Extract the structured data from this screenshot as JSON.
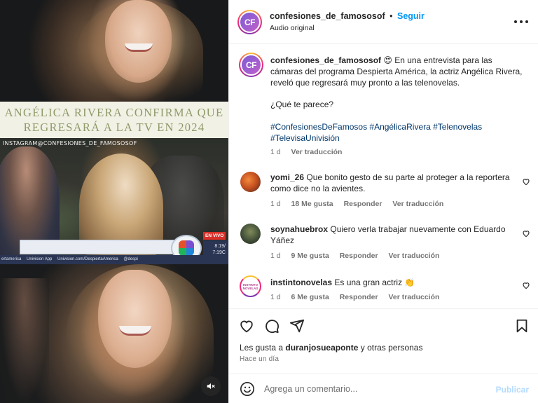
{
  "media": {
    "headline_line1": "ANGÉLICA RIVERA CONFIRMA QUE",
    "headline_line2": "REGRESARÁ A LA TV EN 2024",
    "watermark": "INSTAGRAM@CONFESIONES_DE_FAMOSOSOF",
    "live_badge": "EN VIVO",
    "time_line1": "8:19/",
    "time_line2": "7:19C",
    "ticker": [
      "ertamerica",
      "Univision App",
      "Univision.com/DespiertaAmerica",
      "@despi"
    ],
    "mute_icon": "muted-speaker-icon"
  },
  "header": {
    "avatar_text": "CF",
    "username": "confesiones_de_famososof",
    "separator": "•",
    "follow": "Seguir",
    "subtitle": "Audio original",
    "more_icon": "more-options-icon"
  },
  "caption": {
    "username": "confesiones_de_famososof",
    "emoji": "😍",
    "body": "En una entrevista para las cámaras del programa Despierta América, la actriz Angélica Rivera, reveló que regresará muy pronto a las telenovelas.",
    "question": "¿Qué te parece?",
    "hashtags_line1": "#ConfesionesDeFamosos #AngélicaRivera #Telenovelas",
    "hashtags_line2": "#TelevisaUnivisión",
    "time": "1 d",
    "translate": "Ver traducción"
  },
  "comments": [
    {
      "username": "yomi_26",
      "text": "Que bonito gesto de su parte al proteger a la reportera como dice no la avientes.",
      "time": "1 d",
      "likes": "18 Me gusta",
      "reply": "Responder",
      "translate": "Ver traducción"
    },
    {
      "username": "soynahuebrox",
      "text": "Quiero verla trabajar nuevamente con Eduardo Yáñez",
      "time": "1 d",
      "likes": "9 Me gusta",
      "reply": "Responder",
      "translate": "Ver traducción"
    },
    {
      "username": "instintonovelas",
      "avatar_text": "INSTINTO NOVELAS",
      "text": "Es una gran actriz",
      "emoji": "👏",
      "time": "1 d",
      "likes": "6 Me gusta",
      "reply": "Responder",
      "translate": "Ver traducción"
    }
  ],
  "likes": {
    "prefix": "Les gusta a",
    "user": "duranjosueaponte",
    "suffix": "y otras personas"
  },
  "timestamp": "Hace un día",
  "comment_box": {
    "placeholder": "Agrega un comentario...",
    "post": "Publicar"
  },
  "colors": {
    "link_blue": "#0095f6",
    "hashtag": "#00376b",
    "muted_text": "#737373",
    "headline_olive": "#8f9a6a",
    "post_disabled": "#b3dbff"
  }
}
